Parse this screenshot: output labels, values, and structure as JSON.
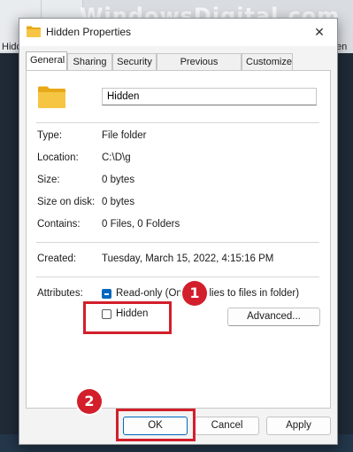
{
  "background": {
    "watermark": "WindowsDigital.com",
    "desktop_labels": [
      "Hidd",
      "en"
    ]
  },
  "dialog": {
    "title": "Hidden Properties",
    "close_glyph": "✕",
    "tabs": [
      "General",
      "Sharing",
      "Security",
      "Previous Versions",
      "Customize"
    ],
    "active_tab": "General",
    "folder_name": "Hidden",
    "info": [
      {
        "label": "Type:",
        "value": "File folder"
      },
      {
        "label": "Location:",
        "value": "C:\\D\\g"
      },
      {
        "label": "Size:",
        "value": "0 bytes"
      },
      {
        "label": "Size on disk:",
        "value": "0 bytes"
      },
      {
        "label": "Contains:",
        "value": "0 Files, 0 Folders"
      }
    ],
    "created": {
      "label": "Created:",
      "value": "Tuesday, March 15, 2022, 4:15:16 PM"
    },
    "attributes": {
      "label": "Attributes:",
      "readonly_label": "Read-only (Only applies to files in folder)",
      "readonly_state": "indeterminate",
      "hidden_label": "Hidden",
      "hidden_checked": false,
      "advanced_label": "Advanced..."
    },
    "buttons": {
      "ok": "OK",
      "cancel": "Cancel",
      "apply": "Apply"
    }
  },
  "annotations": {
    "step1": "1",
    "step2": "2",
    "color": "#d21f2b"
  },
  "colors": {
    "accent": "#0067c0",
    "folder": "#f6c544"
  }
}
